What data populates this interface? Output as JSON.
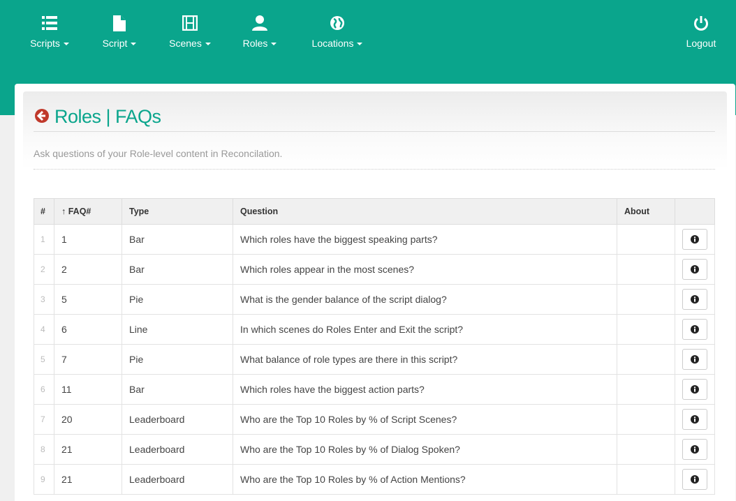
{
  "nav": {
    "items": [
      {
        "label": "Scripts",
        "icon": "list-icon"
      },
      {
        "label": "Script",
        "icon": "file-icon"
      },
      {
        "label": "Scenes",
        "icon": "film-icon"
      },
      {
        "label": "Roles",
        "icon": "user-icon"
      },
      {
        "label": "Locations",
        "icon": "globe-icon"
      }
    ],
    "logout": {
      "label": "Logout",
      "icon": "power-icon"
    }
  },
  "page": {
    "title": "Roles | FAQs",
    "subtitle": "Ask questions of your Role-level content in Reconcilation."
  },
  "table": {
    "headers": {
      "num": "#",
      "faq": "↑ FAQ#",
      "type": "Type",
      "question": "Question",
      "about": "About"
    },
    "rows": [
      {
        "num": "1",
        "faq": "1",
        "type": "Bar",
        "question": "Which roles have the biggest speaking parts?"
      },
      {
        "num": "2",
        "faq": "2",
        "type": "Bar",
        "question": "Which roles appear in the most scenes?"
      },
      {
        "num": "3",
        "faq": "5",
        "type": "Pie",
        "question": "What is the gender balance of the script dialog?"
      },
      {
        "num": "4",
        "faq": "6",
        "type": "Line",
        "question": "In which scenes do Roles Enter and Exit the script?"
      },
      {
        "num": "5",
        "faq": "7",
        "type": "Pie",
        "question": "What balance of role types are there in this script?"
      },
      {
        "num": "6",
        "faq": "11",
        "type": "Bar",
        "question": "Which roles have the biggest action parts?"
      },
      {
        "num": "7",
        "faq": "20",
        "type": "Leaderboard",
        "question": "Who are the Top 10 Roles by % of Script Scenes?"
      },
      {
        "num": "8",
        "faq": "21",
        "type": "Leaderboard",
        "question": "Who are the Top 10 Roles by % of Dialog Spoken?"
      },
      {
        "num": "9",
        "faq": "21",
        "type": "Leaderboard",
        "question": "Who are the Top 10 Roles by % of Action Mentions?"
      }
    ]
  },
  "colors": {
    "brand": "#0aa58c",
    "back_icon": "#c0392b"
  }
}
